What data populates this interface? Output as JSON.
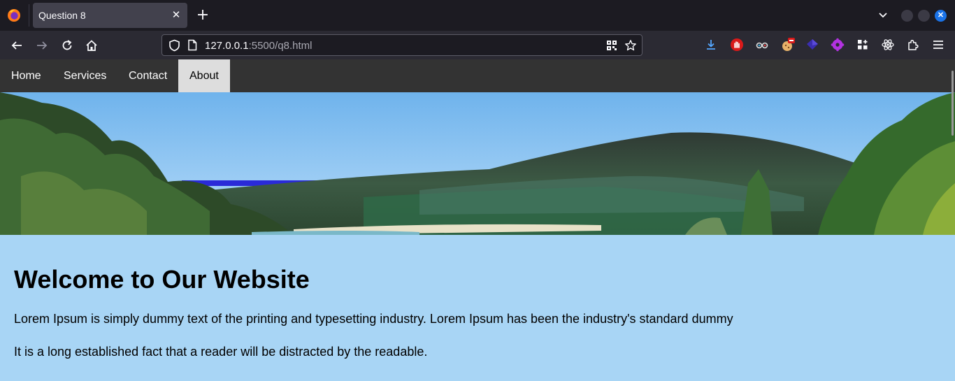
{
  "browser": {
    "tab": {
      "title": "Question 8",
      "close_glyph": "✕"
    },
    "new_tab_glyph": "+",
    "url": {
      "host": "127.0.0.1",
      "rest": ":5500/q8.html"
    },
    "window_close_glyph": "✕"
  },
  "site": {
    "nav": [
      {
        "label": "Home",
        "active": false
      },
      {
        "label": "Services",
        "active": false
      },
      {
        "label": "Contact",
        "active": false
      },
      {
        "label": "About",
        "active": true
      }
    ],
    "heading": "Welcome to Our Website",
    "paragraphs": [
      "Lorem Ipsum is simply dummy text of the printing and typesetting industry. Lorem Ipsum has been the industry's standard dummy",
      "It is a long established fact that a reader will be distracted by the readable."
    ]
  },
  "colors": {
    "page_bg": "#a8d5f5",
    "nav_bg": "#333333",
    "nav_active_bg": "#dddddd"
  }
}
